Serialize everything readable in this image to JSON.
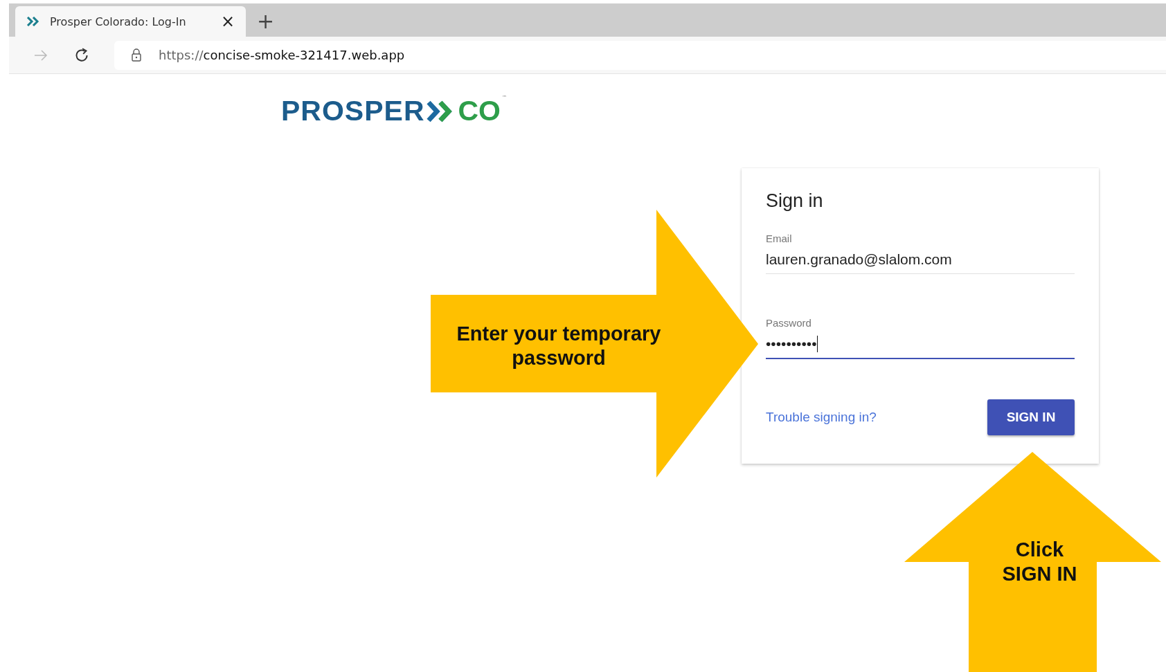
{
  "browser": {
    "tab": {
      "title": "Prosper Colorado: Log-In",
      "close": "×",
      "selected": true
    },
    "new_tab": "+",
    "url_scheme": "https://",
    "url_host": "concise-smoke-321417.web.app"
  },
  "logo": {
    "left": "PROSPER",
    "right": "CO",
    "mark": "™"
  },
  "sign_in": {
    "title": "Sign in",
    "fields": [
      {
        "label": "Email",
        "value": "lauren.granado@slalom.com",
        "focused": false
      },
      {
        "label": "Password",
        "value": "••••••••••",
        "focused": true
      }
    ],
    "link": "Trouble signing in?",
    "button": "SIGN IN"
  },
  "callouts": [
    {
      "kind": "right",
      "text": "Enter your temporary password"
    },
    {
      "kind": "up",
      "lines": [
        "Click",
        "SIGN IN"
      ]
    }
  ]
}
